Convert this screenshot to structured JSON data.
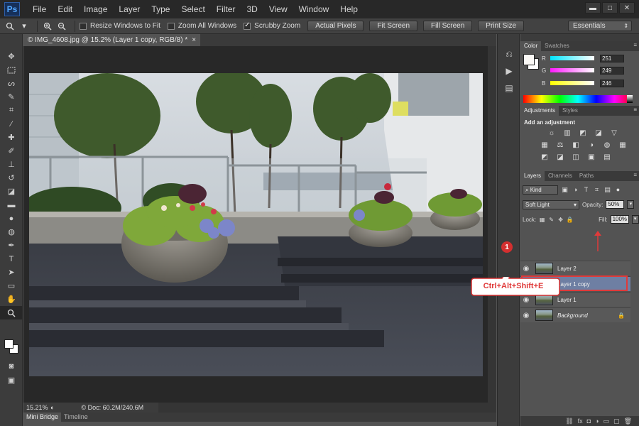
{
  "app": {
    "logo": "Ps"
  },
  "menu": [
    "File",
    "Edit",
    "Image",
    "Layer",
    "Type",
    "Select",
    "Filter",
    "3D",
    "View",
    "Window",
    "Help"
  ],
  "window_controls": {
    "minimize": "▬",
    "maximize": "□",
    "close": "✕"
  },
  "options": {
    "resize_windows": "Resize Windows to Fit",
    "zoom_all": "Zoom All Windows",
    "scrubby_zoom": "Scrubby Zoom",
    "actual_pixels": "Actual Pixels",
    "fit_screen": "Fit Screen",
    "fill_screen": "Fill Screen",
    "print_size": "Print Size",
    "workspace": "Essentials"
  },
  "document": {
    "tab_title": "© IMG_4608.jpg @ 15.2% (Layer 1 copy, RGB/8) *",
    "tab_close": "×",
    "zoom": "15.21%",
    "doc_info": "© Doc: 60.2M/240.6M"
  },
  "bottom_tabs": [
    "Mini Bridge",
    "Timeline"
  ],
  "color_panel": {
    "tabs": [
      "Color",
      "Swatches"
    ],
    "channels": [
      {
        "label": "R",
        "value": "251",
        "color": "#00e5ff"
      },
      {
        "label": "G",
        "value": "249",
        "color": "#ff19ff"
      },
      {
        "label": "B",
        "value": "246",
        "color": "#ffff00"
      }
    ]
  },
  "adjustments_panel": {
    "tabs": [
      "Adjustments",
      "Styles"
    ],
    "title": "Add an adjustment"
  },
  "layers_panel": {
    "tabs": [
      "Layers",
      "Channels",
      "Paths"
    ],
    "kind": "Kind",
    "blend_mode": "Soft Light",
    "opacity_label": "Opacity:",
    "opacity": "50%",
    "lock_label": "Lock:",
    "fill_label": "Fill:",
    "fill": "100%",
    "layers": [
      {
        "name": "Layer 2"
      },
      {
        "name": "Layer 1 copy"
      },
      {
        "name": "Layer 1"
      },
      {
        "name": "Background"
      }
    ]
  },
  "annotation": {
    "step": "1",
    "shortcut": "Ctrl+Alt+Shift+E"
  }
}
